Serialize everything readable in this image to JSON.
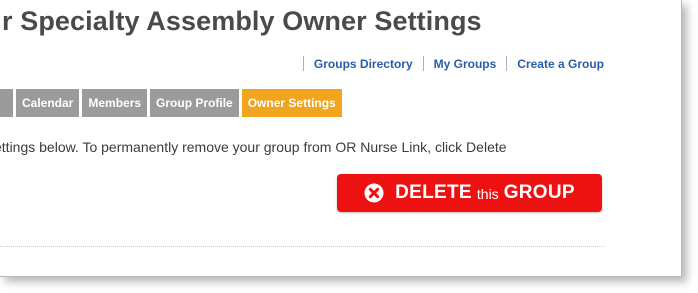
{
  "header": {
    "title": "r Specialty Assembly Owner Settings"
  },
  "top_links": [
    {
      "label": "Groups Directory"
    },
    {
      "label": "My Groups"
    },
    {
      "label": "Create a Group"
    }
  ],
  "tabs": [
    {
      "label": ""
    },
    {
      "label": "Calendar"
    },
    {
      "label": "Members"
    },
    {
      "label": "Group Profile"
    },
    {
      "label": "Owner Settings",
      "active": true
    }
  ],
  "main": {
    "instructions": "ettings below. To permanently remove your group from OR Nurse Link, click Delete",
    "delete_button": {
      "icon": "close-circle-icon",
      "label_strong_1": "DELETE",
      "label_small": "this",
      "label_strong_2": "GROUP"
    }
  },
  "colors": {
    "title": "#4a4a4a",
    "link": "#2a5da8",
    "tab": "#9b9b9b",
    "tab_active": "#f0a41f",
    "delete_button": "#ee1111"
  }
}
